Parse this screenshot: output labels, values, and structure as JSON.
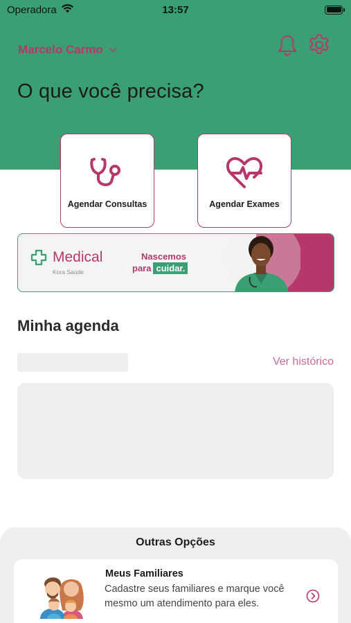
{
  "status_bar": {
    "carrier": "Operadora",
    "time": "13:57"
  },
  "header": {
    "user_name": "Marcelo Carmo",
    "title": "O que você precisa?"
  },
  "quick_actions": [
    {
      "label": "Agendar Consultas",
      "icon": "stethoscope-icon"
    },
    {
      "label": "Agendar Exames",
      "icon": "heart-pulse-icon"
    }
  ],
  "banner": {
    "brand": "Medical",
    "brand_sub": "Kora Saúde",
    "tagline_1": "Nascemos",
    "tagline_2": "para",
    "tagline_3": "cuidar."
  },
  "agenda": {
    "title": "Minha agenda",
    "history_link": "Ver histórico"
  },
  "other_options": {
    "title": "Outras Opções",
    "items": [
      {
        "title": "Meus Familiares",
        "description": "Cadastre seus familiares e marque você mesmo um atendimento para eles."
      }
    ]
  },
  "colors": {
    "brand_green": "#3a9f72",
    "brand_pink": "#b5386b"
  }
}
